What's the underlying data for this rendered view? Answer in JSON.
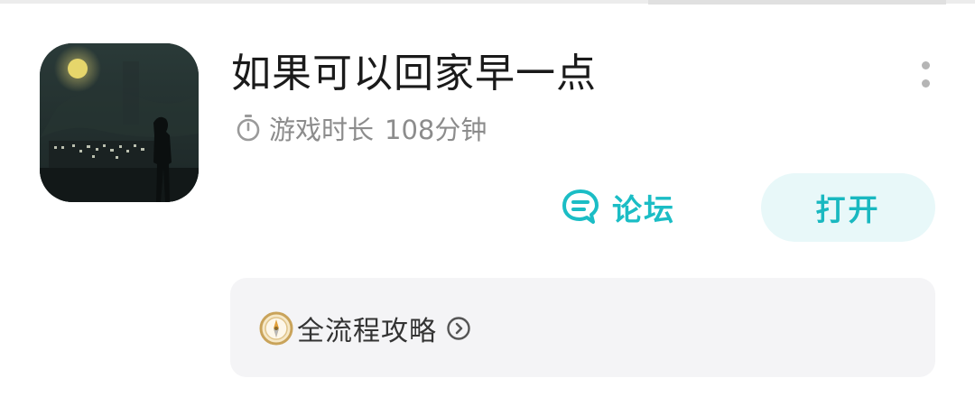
{
  "game": {
    "title": "如果可以回家早一点",
    "icon": "night-city-silhouette-game-icon",
    "playtime_label": "游戏时长",
    "playtime_value": "108分钟"
  },
  "actions": {
    "forum_label": "论坛",
    "open_label": "打开"
  },
  "guide": {
    "label": "全流程攻略"
  },
  "colors": {
    "accent": "#1bbdc5",
    "open_button_bg": "#e8f8f9",
    "card_bg": "#f4f4f6",
    "muted_text": "#8c8c8c"
  }
}
